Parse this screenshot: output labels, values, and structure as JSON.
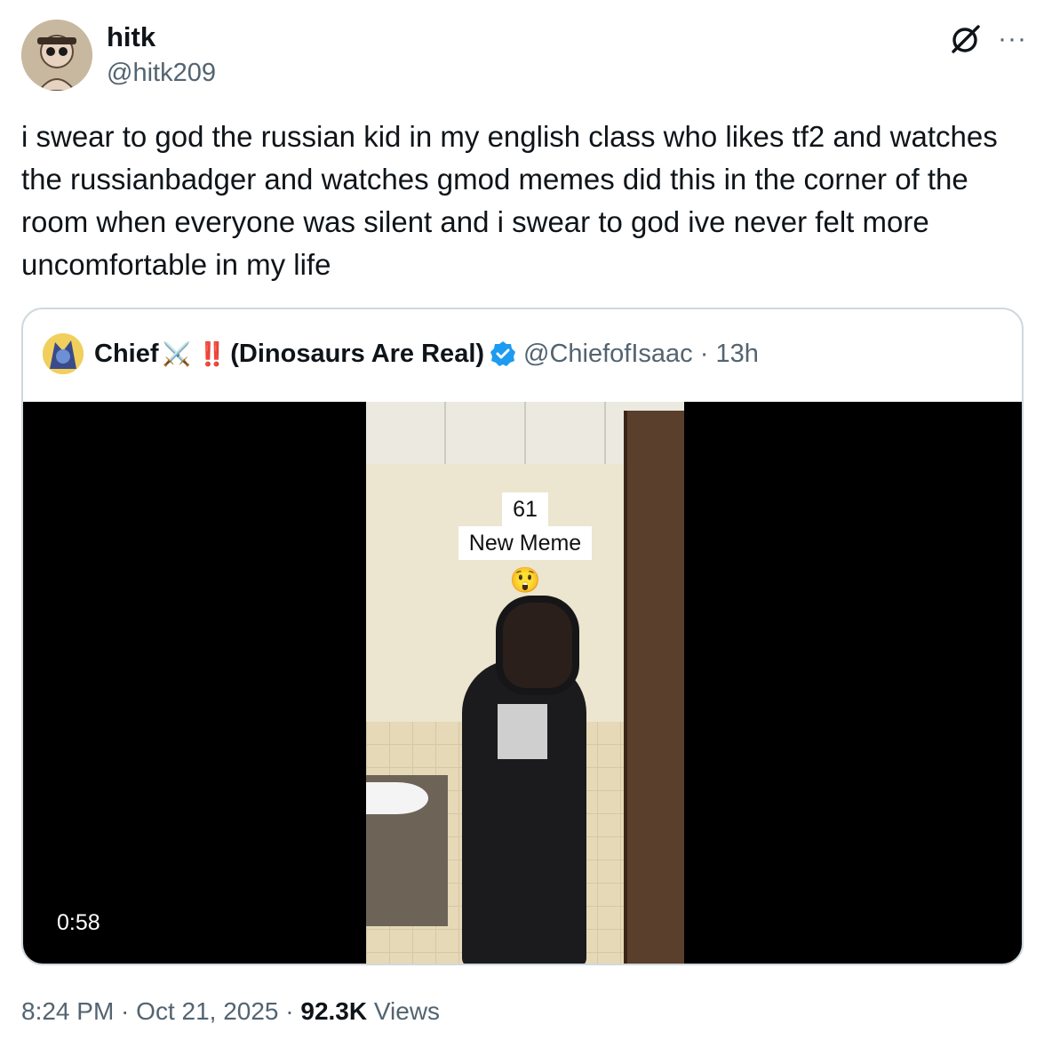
{
  "author": {
    "display_name": "hitk",
    "handle": "@hitk209",
    "avatar_icon": "cartoon-avatar-sunglasses"
  },
  "tweet": {
    "text": "i swear to god the russian kid in my english class who likes tf2 and watches the russianbadger and watches gmod memes did this in the corner of the room when everyone was silent and i swear to god ive never felt more uncomfortable in my life"
  },
  "top_icons": {
    "grok": "grok-icon",
    "more": "···"
  },
  "quoted_tweet": {
    "display_name": "Chief",
    "emoji_swords": "⚔️",
    "emoji_exclaim": "‼️",
    "name_suffix": "(Dinosaurs Are Real)",
    "verified_icon": "verified-badge-icon",
    "verified_color": "#1d9bf0",
    "handle_time": "@ChiefofIsaac · 13h",
    "video": {
      "caption_line1": "61",
      "caption_line2": "New Meme",
      "caption_emoji": "😲",
      "duration": "0:58"
    }
  },
  "meta": {
    "time_date": "8:24 PM · Oct 21, 2025 · ",
    "views_count": "92.3K",
    "views_label": " Views"
  },
  "colors": {
    "text": "#0f1419",
    "secondary": "#536471",
    "border": "#cfd9de"
  }
}
